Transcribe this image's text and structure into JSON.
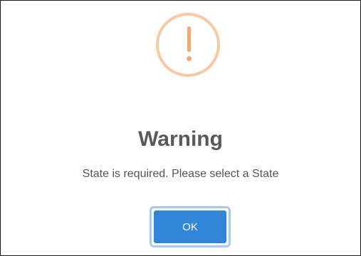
{
  "dialog": {
    "icon": "warning-exclamation-icon",
    "title": "Warning",
    "message": "State is required. Please select a State",
    "ok_label": "OK"
  },
  "colors": {
    "icon_ring": "#f8c9a4",
    "icon_mark": "#f4a870",
    "button": "#3085d6",
    "button_focus_ring": "#a9c9ec",
    "title_text": "#595959",
    "message_text": "#545454"
  }
}
